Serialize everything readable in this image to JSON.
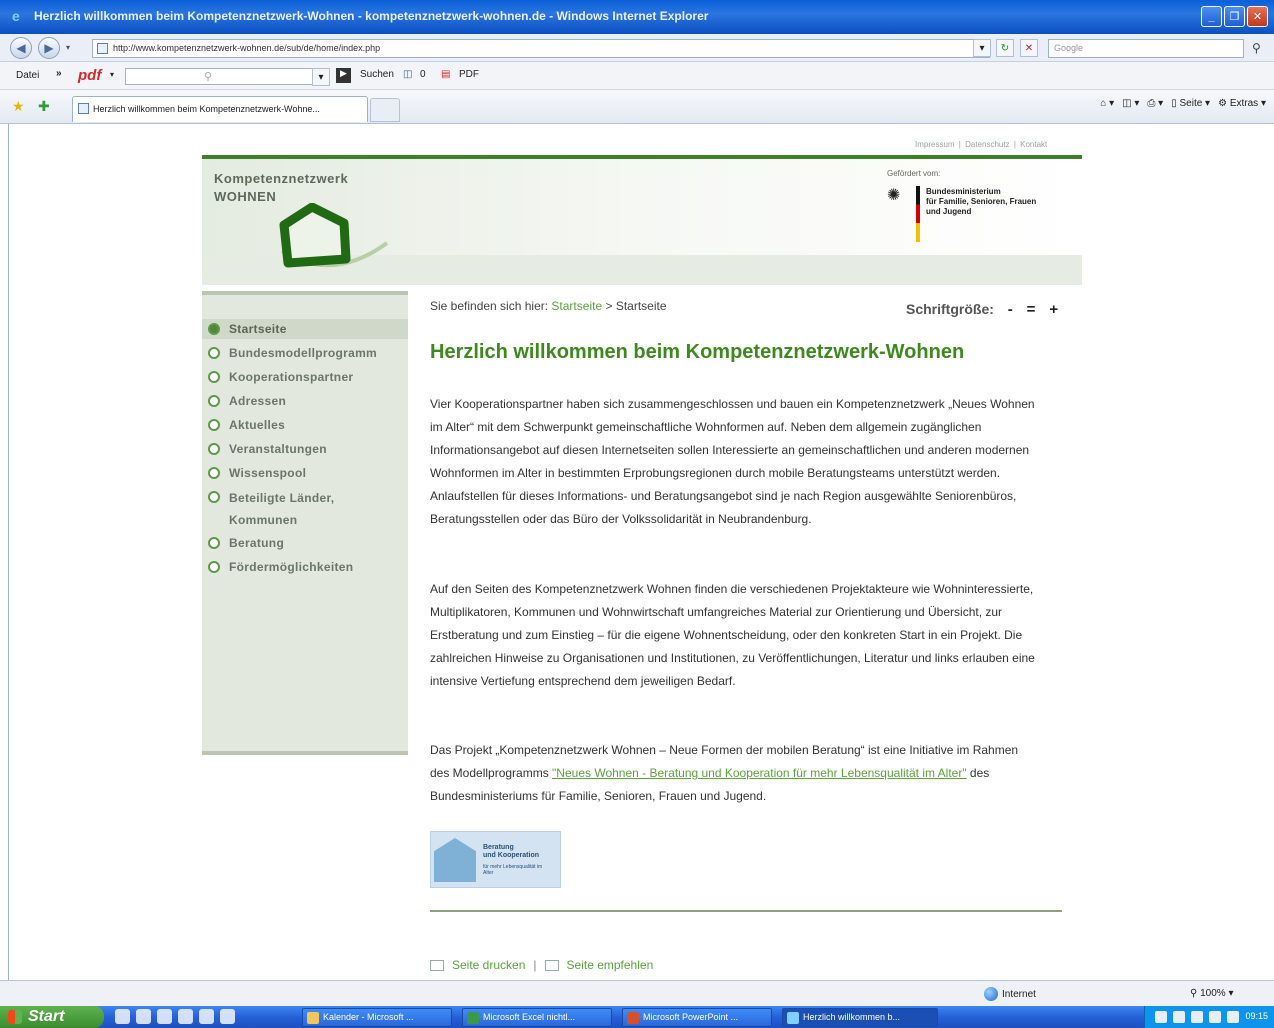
{
  "window": {
    "title": "Herzlich willkommen beim Kompetenznetzwerk-Wohnen - kompetenznetzwerk-wohnen.de - Windows Internet Explorer"
  },
  "browser": {
    "url": "http://www.kompetenznetzwerk-wohnen.de/sub/de/home/index.php",
    "search_placeholder": "Google",
    "menu_file": "Datei",
    "menu_more": "»",
    "pdf_label": "pdf",
    "search_button": "Suchen",
    "counter": "0",
    "pdf_button": "PDF",
    "tab_title": "Herzlich willkommen beim Kompetenznetzwerk-Wohne...",
    "cmd_page": "Seite",
    "cmd_tools": "Extras",
    "status_zone": "Internet",
    "zoom": "100%"
  },
  "site": {
    "topnav": [
      "Impressum",
      "Datenschutz",
      "Kontakt"
    ],
    "topnav_sep": "|",
    "logo_line1": "Kompetenznetzwerk",
    "logo_line2": "WOHNEN",
    "funded_by": "Gefördert vom:",
    "ministry": [
      "Bundesministerium",
      "für Familie, Senioren, Frauen",
      "und Jugend"
    ],
    "nav": [
      {
        "label": "Startseite"
      },
      {
        "label": "Bundesmodellprogramm"
      },
      {
        "label": "Kooperationspartner"
      },
      {
        "label": "Adressen"
      },
      {
        "label": "Aktuelles"
      },
      {
        "label": "Veranstaltungen"
      },
      {
        "label": "Wissenspool"
      },
      {
        "label": "Beteiligte Länder, Kommunen"
      },
      {
        "label": "Beratung"
      },
      {
        "label": "Fördermöglichkeiten"
      }
    ],
    "breadcrumb_prefix": "Sie befinden sich hier:",
    "breadcrumb_link": "Startseite",
    "breadcrumb_sep": ">",
    "breadcrumb_current": "Startseite",
    "fontsize_label": "Schriftgröße:",
    "fontsize_minus": "-",
    "fontsize_reset": "=",
    "fontsize_plus": "+",
    "page_title": "Herzlich willkommen beim Kompetenznetzwerk-Wohnen",
    "para1": "Vier Kooperationspartner haben sich zusammengeschlossen und bauen ein Kompetenznetzwerk „Neues Wohnen im Alter“ mit dem Schwerpunkt gemeinschaftliche Wohnformen auf. Neben dem allgemein zugänglichen Informationsangebot auf diesen Internetseiten sollen Interessierte an gemeinschaftlichen und anderen modernen Wohnformen im Alter in bestimmten Erprobungsregionen durch mobile Beratungsteams unterstützt werden. Anlaufstellen für dieses Informations- und Beratungsangebot sind je nach Region ausgewählte Seniorenbüros, Beratungsstellen oder das Büro der Volkssolidarität in Neubrandenburg.",
    "para2": "Auf den Seiten des Kompetenznetzwerk Wohnen finden die verschiedenen Projektakteure wie Wohninteressierte, Multiplikatoren, Kommunen und Wohnwirtschaft umfangreiches Material zur Orientierung und Übersicht, zur Erstberatung und zum Einstieg – für die eigene Wohnentscheidung, oder den konkreten Start in ein Projekt. Die zahlreichen Hinweise zu Organisationen und Institutionen, zu Veröffentlichungen, Literatur und links erlauben eine intensive Vertiefung entsprechend dem jeweiligen Bedarf.",
    "para3_before": "Das Projekt „Kompetenznetzwerk Wohnen – Neue Formen der mobilen Beratung“ ist eine Initiative im Rahmen des Modellprogramms ",
    "para3_link": "\"Neues Wohnen - Beratung und Kooperation für mehr Lebensqualität im Alter\"",
    "para3_after": " des Bundesministeriums für Familie, Senioren, Frauen und Jugend.",
    "promo_line1": "Beratung",
    "promo_line2": "und Kooperation",
    "promo_small": "für mehr Lebensqualität im Alter",
    "print_link": "Seite drucken",
    "footer_sep": "|",
    "recommend_link": "Seite empfehlen"
  },
  "taskbar": {
    "start": "Start",
    "tasks": [
      {
        "label": "Kalender - Microsoft ..."
      },
      {
        "label": "Microsoft Excel nichtl..."
      },
      {
        "label": "Microsoft PowerPoint ..."
      },
      {
        "label": "Herzlich willkommen b..."
      }
    ],
    "time": "09:15"
  },
  "colors": {
    "brand_green": "#3c8a1e",
    "link_green": "#5aa23c",
    "sidebar_bg": "#e3e8df",
    "xp_blue": "#2661d6"
  }
}
